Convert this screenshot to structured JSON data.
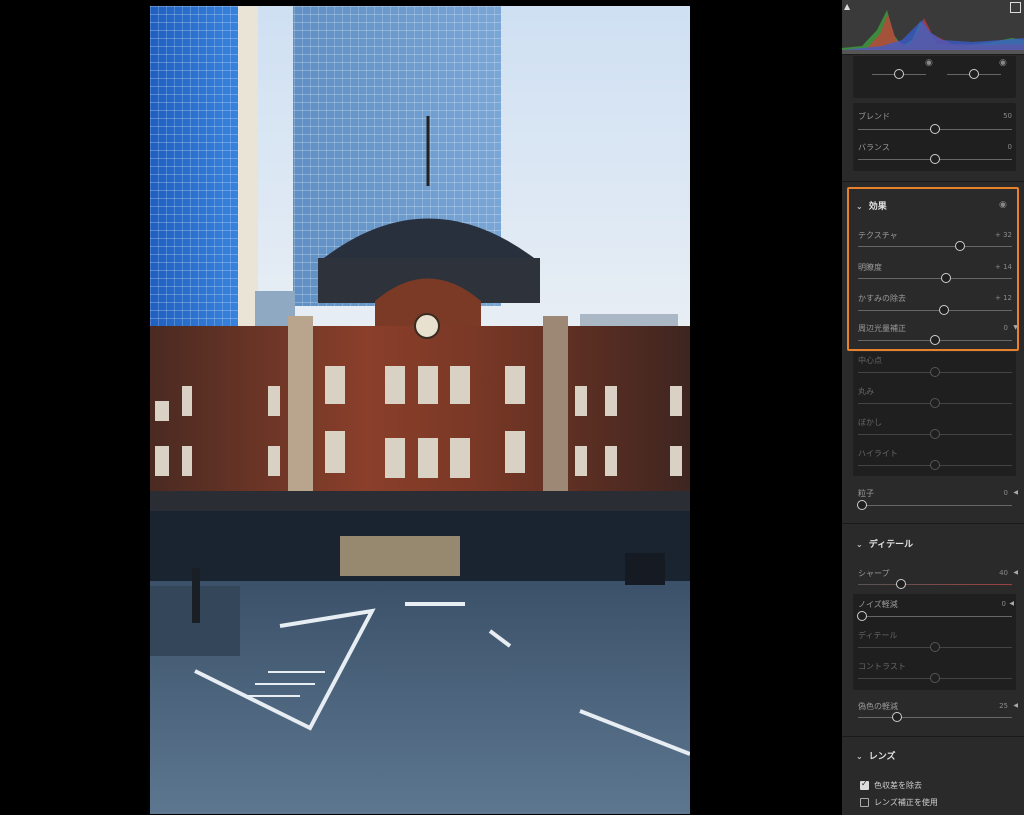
{
  "panel": {
    "top_group": {
      "sliders": [
        {
          "label": "ブレンド",
          "value": "50",
          "pos": 0.5
        },
        {
          "label": "バランス",
          "value": "0",
          "pos": 0.5
        }
      ]
    },
    "effects": {
      "title": "効果",
      "sliders": [
        {
          "label": "テクスチャ",
          "value": "+ 32",
          "pos": 0.66
        },
        {
          "label": "明瞭度",
          "value": "+ 14",
          "pos": 0.57
        },
        {
          "label": "かすみの除去",
          "value": "+ 12",
          "pos": 0.56
        },
        {
          "label": "周辺光量補正",
          "value": "0",
          "pos": 0.5
        }
      ]
    },
    "vignette": {
      "sliders": [
        {
          "label": "中心点",
          "pos": 0.5
        },
        {
          "label": "丸み",
          "pos": 0.5
        },
        {
          "label": "ぼかし",
          "pos": 0.5
        },
        {
          "label": "ハイライト",
          "pos": 0.5
        }
      ]
    },
    "grain": {
      "label": "粒子",
      "value": "0",
      "pos": 0.0
    },
    "detail": {
      "title": "ディテール",
      "sharpen": {
        "label": "シャープ",
        "value": "40",
        "pos": 0.28
      },
      "noise": {
        "label": "ノイズ軽減",
        "value": "0",
        "pos": 0.0
      },
      "noise_sub": [
        {
          "label": "ディテール",
          "pos": 0.5
        },
        {
          "label": "コントラスト",
          "pos": 0.5
        }
      ],
      "color_noise": {
        "label": "偽色の軽減",
        "value": "25",
        "pos": 0.25
      }
    },
    "lens": {
      "title": "レンズ",
      "options": [
        {
          "label": "色収差を除去",
          "checked": true
        },
        {
          "label": "レンズ補正を使用",
          "checked": false
        }
      ]
    }
  },
  "colors": {
    "accent": "#e8812b",
    "panel_bg": "#2a2a2a",
    "sub_bg": "#1f1f1f"
  }
}
